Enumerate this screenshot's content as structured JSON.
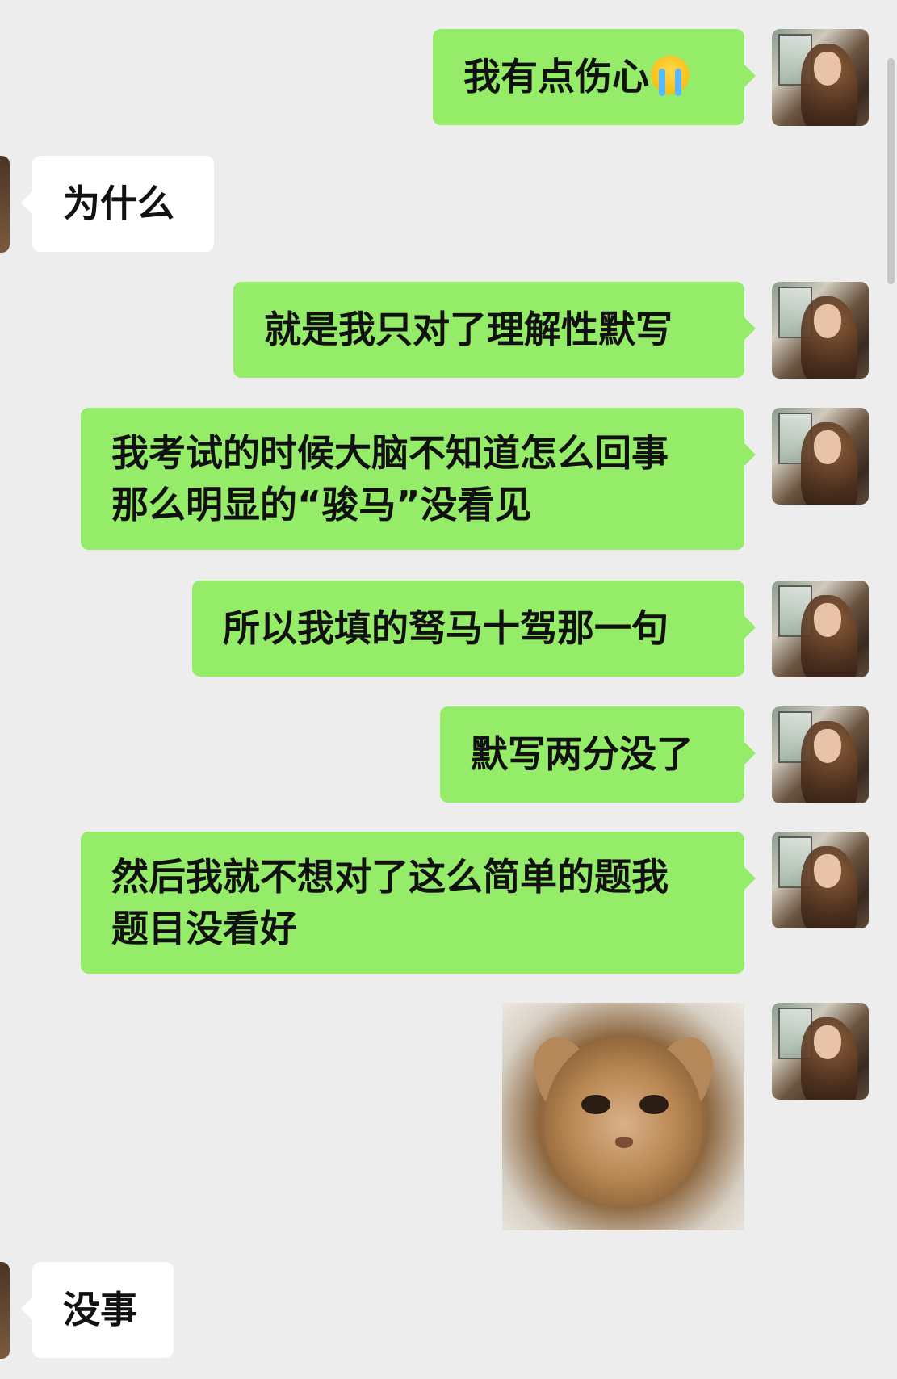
{
  "conversation": {
    "messages": [
      {
        "id": "m1",
        "side": "sent",
        "lines": [
          "我有点伤心"
        ],
        "emoji": "crying-face"
      },
      {
        "id": "m2",
        "side": "received",
        "lines": [
          "为什么"
        ]
      },
      {
        "id": "m3",
        "side": "sent",
        "lines": [
          "就是我只对了理解性默写"
        ]
      },
      {
        "id": "m4",
        "side": "sent",
        "lines": [
          "我考试的时候大脑不知道怎么回事",
          "那么明显的“骏马”没看见"
        ]
      },
      {
        "id": "m5",
        "side": "sent",
        "lines": [
          "所以我填的驽马十驾那一句"
        ]
      },
      {
        "id": "m6",
        "side": "sent",
        "lines": [
          "默写两分没了"
        ]
      },
      {
        "id": "m7",
        "side": "sent",
        "lines": [
          "然后我就不想对了这么简单的题我",
          "题目没看好"
        ]
      },
      {
        "id": "m8",
        "side": "sent",
        "type": "sticker",
        "sticker": "sad-kitten-sticker"
      },
      {
        "id": "m9",
        "side": "received",
        "lines": [
          "没事"
        ]
      }
    ]
  },
  "colors": {
    "background": "#ededed",
    "sent_bubble": "#95ec69",
    "received_bubble": "#ffffff"
  }
}
